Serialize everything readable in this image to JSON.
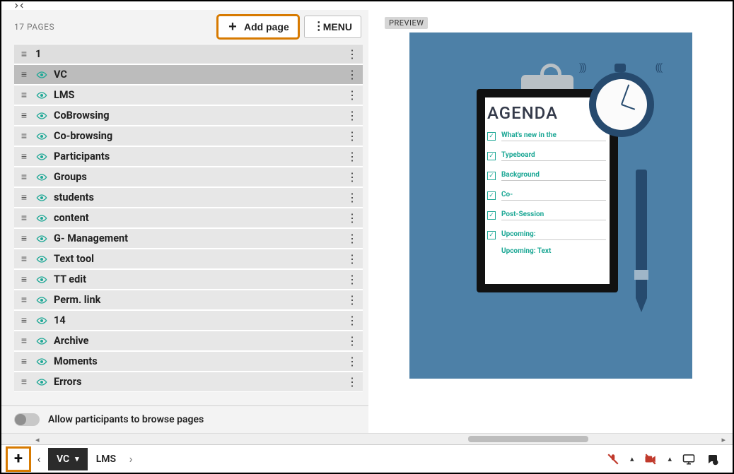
{
  "header": {
    "page_count_label": "17 PAGES",
    "add_page_label": "Add page",
    "menu_label": "MENU"
  },
  "pages": [
    {
      "title": "1"
    },
    {
      "title": "VC",
      "selected": true
    },
    {
      "title": "LMS"
    },
    {
      "title": "CoBrowsing"
    },
    {
      "title": "Co-browsing"
    },
    {
      "title": "Participants"
    },
    {
      "title": "Groups"
    },
    {
      "title": "students"
    },
    {
      "title": "content"
    },
    {
      "title": "G- Management"
    },
    {
      "title": "Text tool"
    },
    {
      "title": "TT edit"
    },
    {
      "title": "Perm. link"
    },
    {
      "title": "14"
    },
    {
      "title": "Archive"
    },
    {
      "title": "Moments"
    },
    {
      "title": "Errors"
    }
  ],
  "allow_browse_label": "Allow participants to browse pages",
  "preview": {
    "badge": "PREVIEW",
    "agenda_title": "AGENDA",
    "items": [
      "What's new in the",
      "Typeboard",
      "Background",
      "Co-",
      "Post-Session",
      "Upcoming:"
    ],
    "extra_line": "Upcoming: Text"
  },
  "tabs": {
    "active": "VC",
    "next": "LMS"
  },
  "colors": {
    "highlight": "#d77a00",
    "preview_bg": "#4d80a7",
    "accent_teal": "#1ea896",
    "danger": "#c0392b"
  }
}
